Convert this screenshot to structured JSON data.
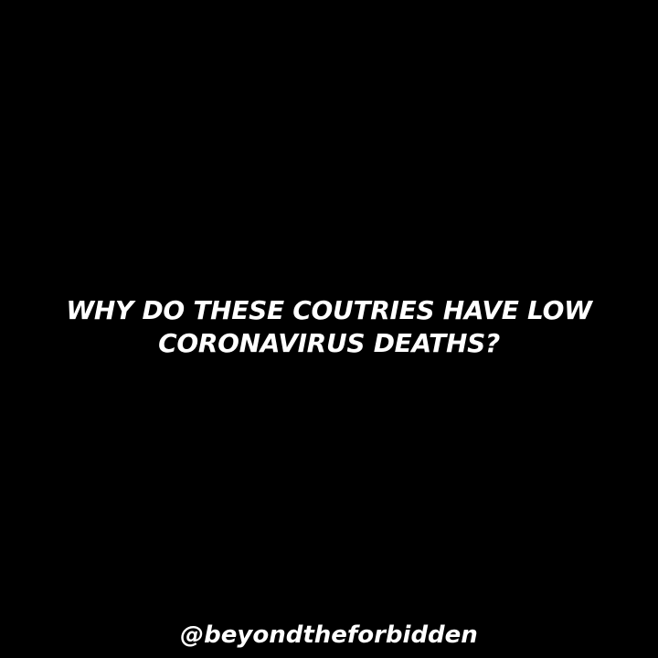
{
  "headline": {
    "line1": "WHY DO THESE COUTRIES HAVE LOW",
    "line2": "CORONAVIRUS DEATHS?"
  },
  "footer": {
    "handle": "@beyondtheforbidden"
  },
  "colors": {
    "background": "#000000",
    "text": "#ffffff"
  }
}
